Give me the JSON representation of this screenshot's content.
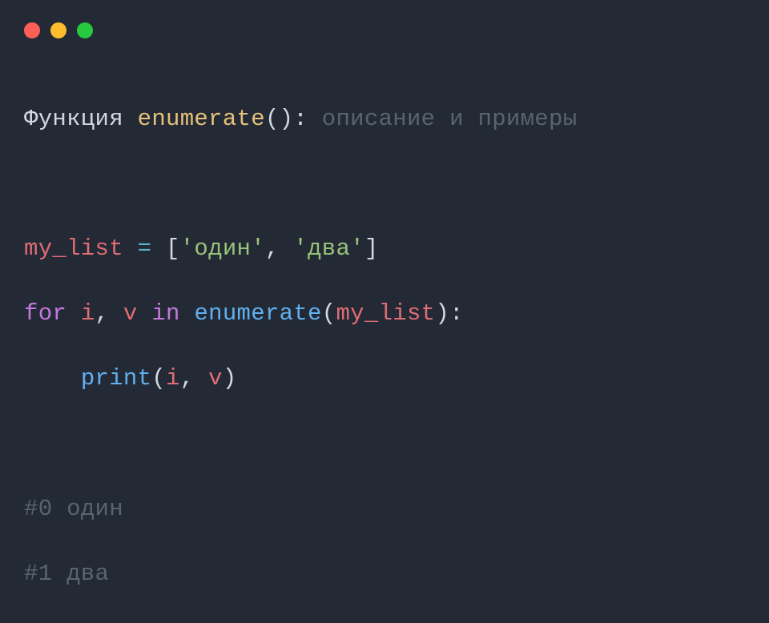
{
  "window": {
    "controls": {
      "close_color": "#ff5f56",
      "minimize_color": "#ffbd2e",
      "zoom_color": "#27c93f"
    }
  },
  "code": {
    "line1": {
      "t1": "Функция ",
      "fn": "enumerate",
      "t2": "(",
      "t3": ")",
      "t4": ": ",
      "comment": "описание и примеры"
    },
    "line3": {
      "ident": "my_list",
      "sp1": " ",
      "op": "=",
      "sp2": " ",
      "lb": "[",
      "s1": "'один'",
      "comma": ", ",
      "s2": "'два'",
      "rb": "]"
    },
    "line4": {
      "kw_for": "for",
      "sp1": " ",
      "i": "i",
      "comma": ", ",
      "v": "v",
      "sp2": " ",
      "kw_in": "in",
      "sp3": " ",
      "fn": "enumerate",
      "lp": "(",
      "arg": "my_list",
      "rp": ")",
      "colon": ":"
    },
    "line5": {
      "indent": "    ",
      "fn": "print",
      "lp": "(",
      "a1": "i",
      "comma": ", ",
      "a2": "v",
      "rp": ")"
    },
    "line7": "#0 один",
    "line8": "#1 два"
  }
}
